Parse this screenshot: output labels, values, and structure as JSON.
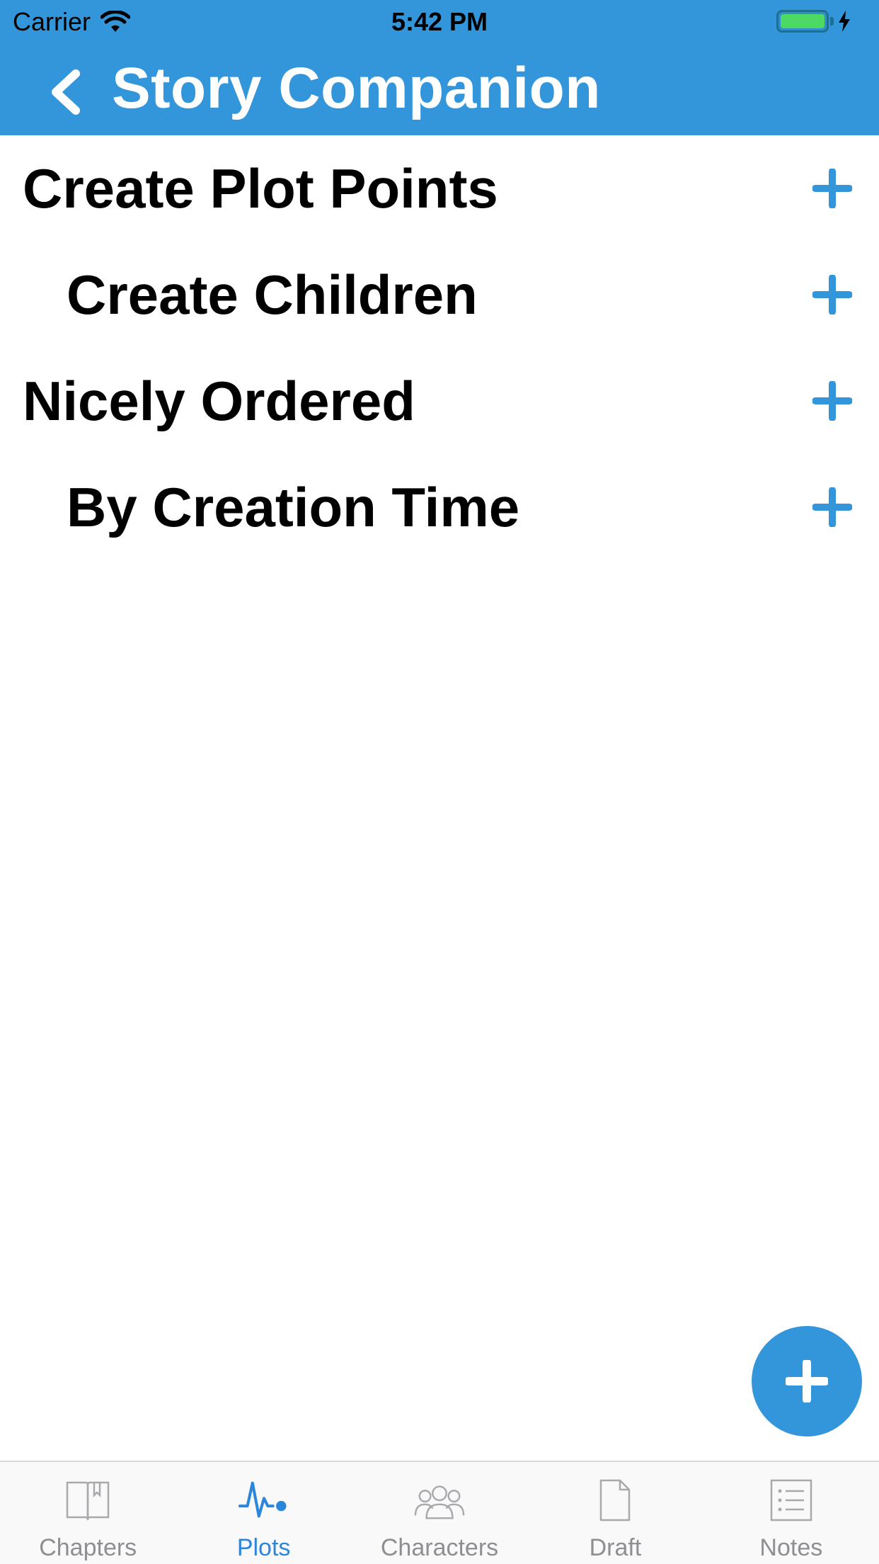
{
  "status_bar": {
    "carrier": "Carrier",
    "time": "5:42 PM"
  },
  "nav": {
    "title": "Story Companion",
    "back_icon": "chevron-left-icon"
  },
  "plots": [
    {
      "title": "Create Plot Points",
      "level": 0
    },
    {
      "title": "Create Children",
      "level": 1
    },
    {
      "title": "Nicely Ordered",
      "level": 0
    },
    {
      "title": "By Creation Time",
      "level": 1
    }
  ],
  "fab": {
    "icon": "plus-icon"
  },
  "tabs": [
    {
      "label": "Chapters",
      "icon": "book-icon",
      "active": false
    },
    {
      "label": "Plots",
      "icon": "pulse-icon",
      "active": true
    },
    {
      "label": "Characters",
      "icon": "people-icon",
      "active": false
    },
    {
      "label": "Draft",
      "icon": "document-icon",
      "active": false
    },
    {
      "label": "Notes",
      "icon": "list-icon",
      "active": false
    }
  ],
  "colors": {
    "accent": "#3396DB",
    "active_tab": "#2b86dc",
    "inactive_tab": "#8e8e93",
    "battery": "#4CD964"
  }
}
